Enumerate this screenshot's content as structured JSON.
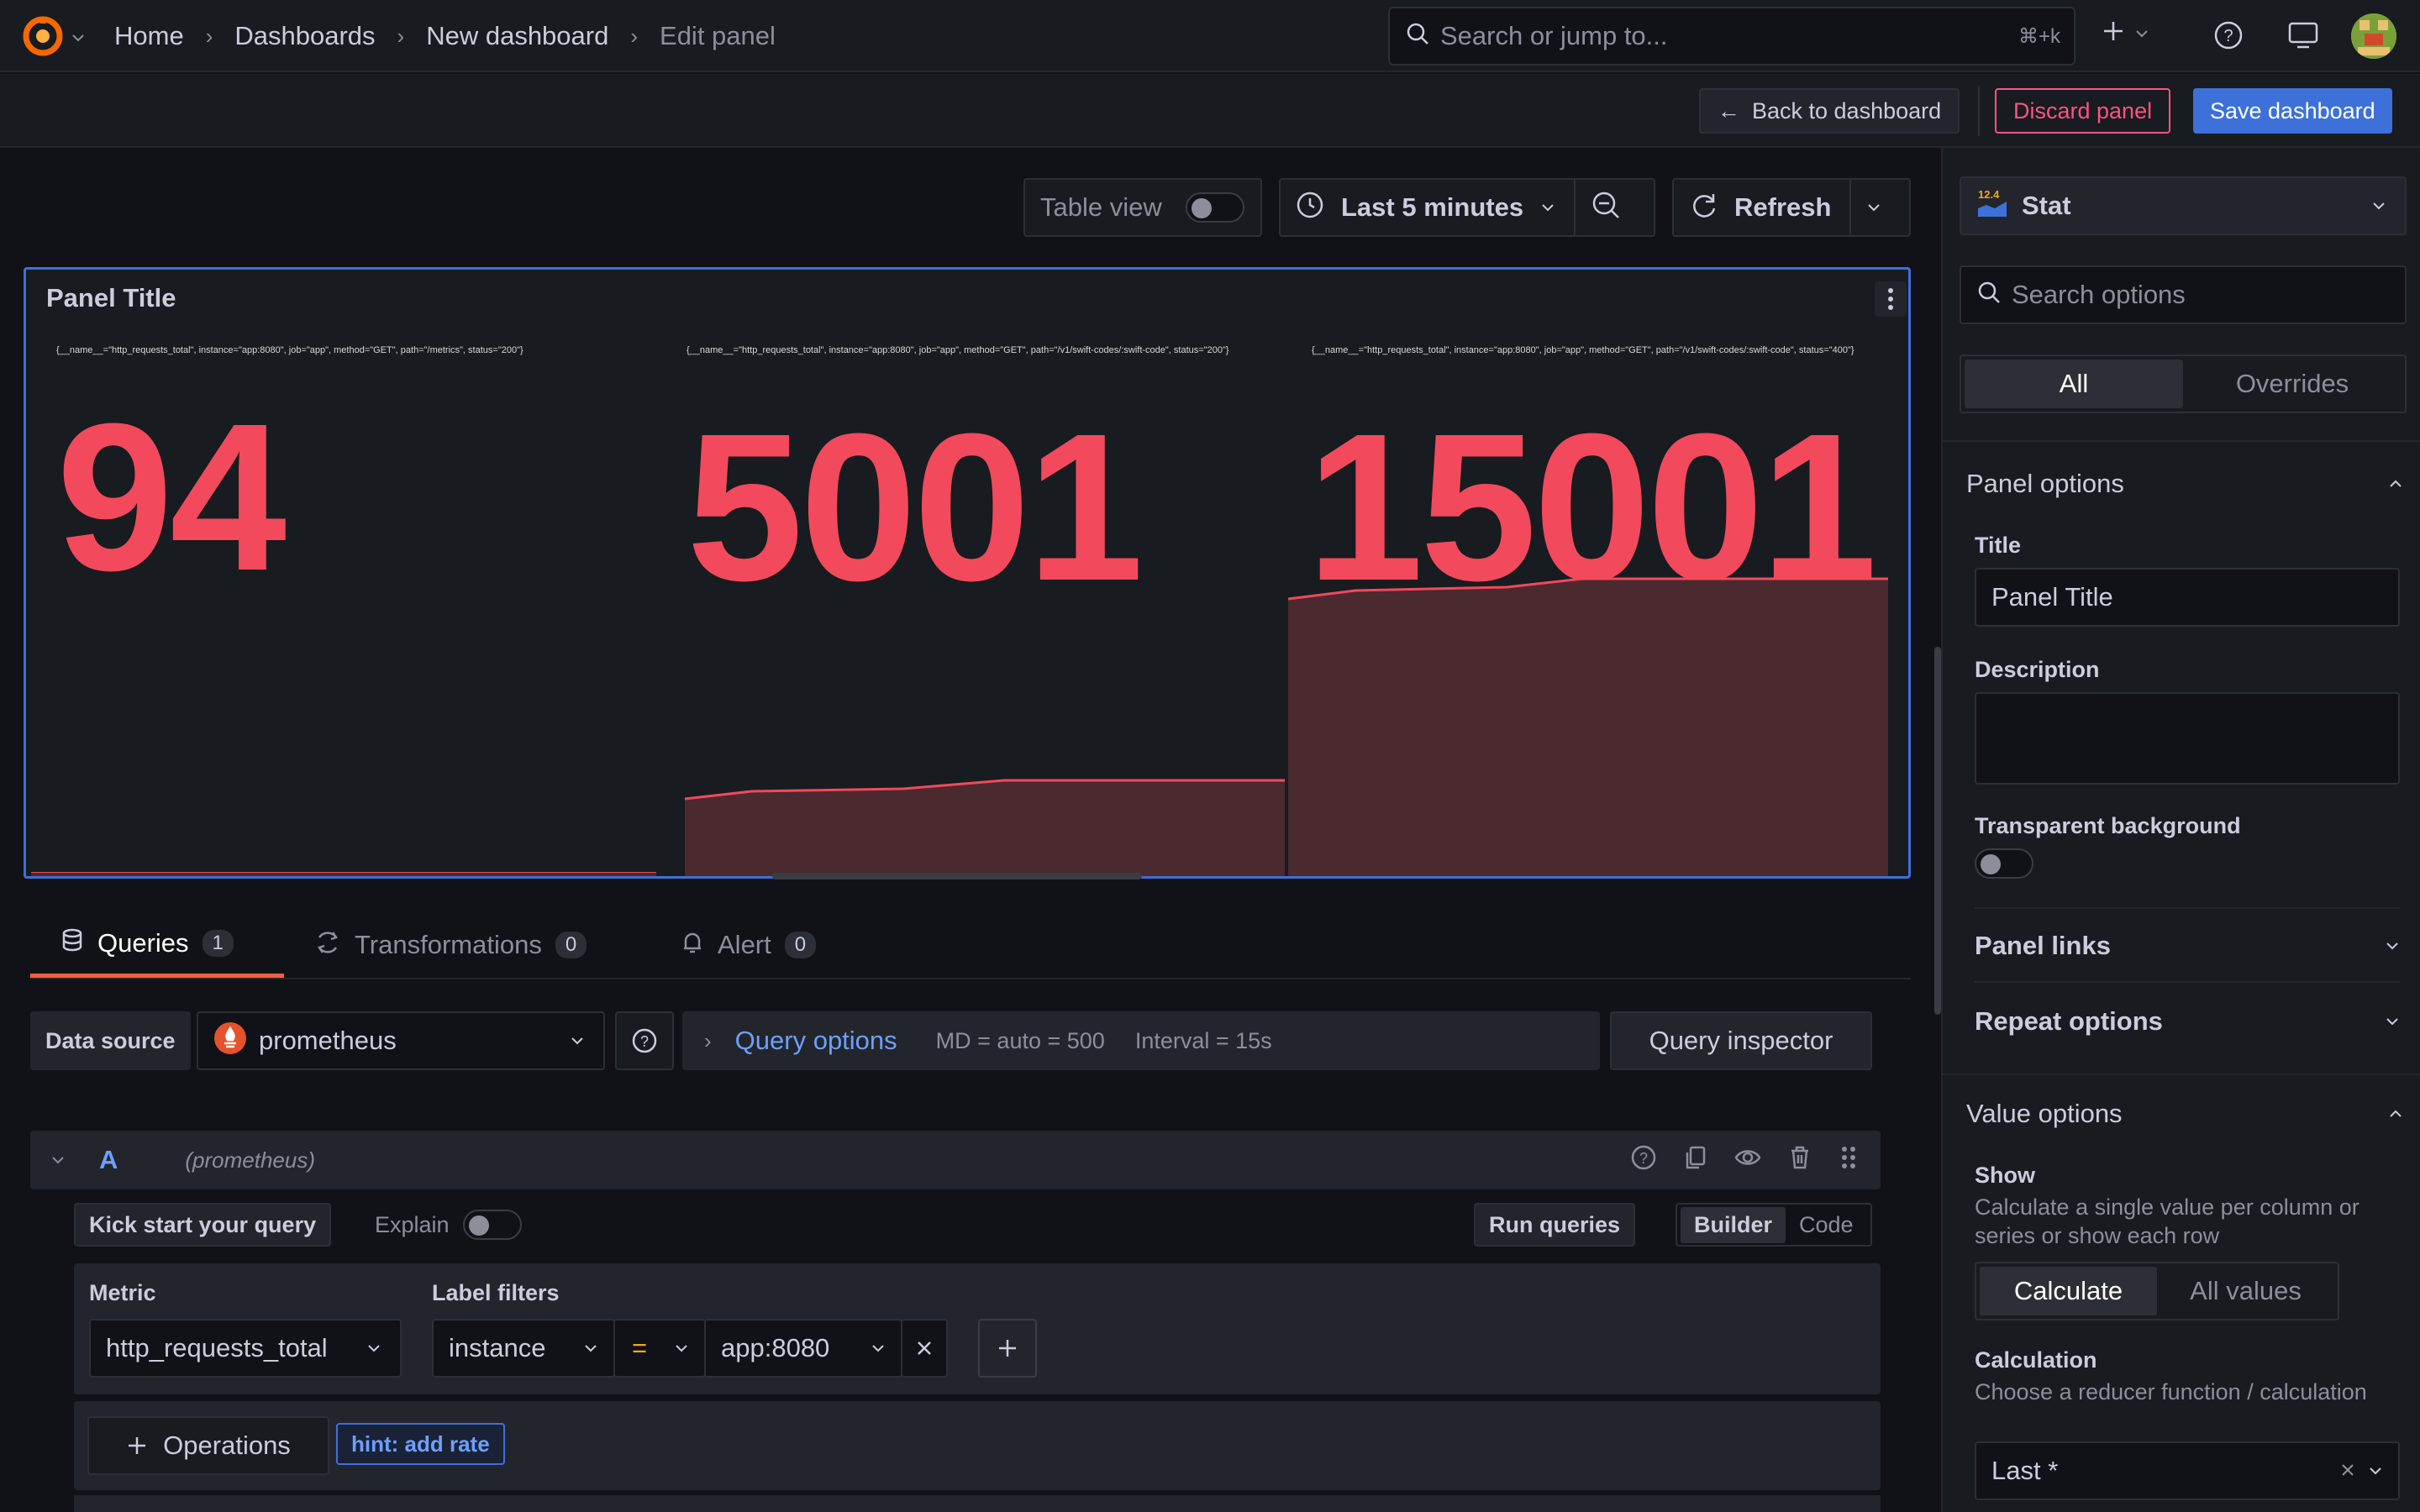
{
  "nav": {
    "breadcrumbs": [
      "Home",
      "Dashboards",
      "New dashboard",
      "Edit panel"
    ],
    "search_placeholder": "Search or jump to...",
    "search_shortcut": "⌘+k"
  },
  "toolbar": {
    "back_label": "Back to dashboard",
    "discard_label": "Discard panel",
    "save_label": "Save dashboard"
  },
  "panel_controls": {
    "table_view_label": "Table view",
    "time_range": "Last 5 minutes",
    "refresh_label": "Refresh"
  },
  "panel": {
    "title": "Panel Title",
    "stats": [
      {
        "label": "{__name__=\"http_requests_total\", instance=\"app:8080\", job=\"app\", method=\"GET\", path=\"/metrics\", status=\"200\"}",
        "value": "94"
      },
      {
        "label": "{__name__=\"http_requests_total\", instance=\"app:8080\", job=\"app\", method=\"GET\", path=\"/v1/swift-codes/:swift-code\", status=\"200\"}",
        "value": "5001"
      },
      {
        "label": "{__name__=\"http_requests_total\", instance=\"app:8080\", job=\"app\", method=\"GET\", path=\"/v1/swift-codes/:swift-code\", status=\"400\"}",
        "value": "15001"
      }
    ]
  },
  "tabs": [
    {
      "label": "Queries",
      "count": "1"
    },
    {
      "label": "Transformations",
      "count": "0"
    },
    {
      "label": "Alert",
      "count": "0"
    }
  ],
  "query": {
    "datasource_label": "Data source",
    "datasource": "prometheus",
    "query_options_label": "Query options",
    "md": "MD = auto = 500",
    "interval": "Interval = 15s",
    "inspector_label": "Query inspector",
    "ref_id": "A",
    "ref_ds": "(prometheus)",
    "kickstart_label": "Kick start your query",
    "explain_label": "Explain",
    "run_label": "Run queries",
    "builder_label": "Builder",
    "code_label": "Code",
    "metric_label": "Metric",
    "metric_value": "http_requests_total",
    "label_filters_label": "Label filters",
    "filter_key": "instance",
    "filter_op": "=",
    "filter_value": "app:8080",
    "operations_label": "Operations",
    "hint_label": "hint: add rate"
  },
  "options": {
    "viz_name": "Stat",
    "search_placeholder": "Search options",
    "all_label": "All",
    "overrides_label": "Overrides",
    "panel_options_title": "Panel options",
    "title_label": "Title",
    "title_value": "Panel Title",
    "description_label": "Description",
    "transparent_label": "Transparent background",
    "panel_links_label": "Panel links",
    "repeat_options_label": "Repeat options",
    "value_options_title": "Value options",
    "show_label": "Show",
    "show_desc": "Calculate a single value per column or series or show each row",
    "calculate_label": "Calculate",
    "all_values_label": "All values",
    "calculation_label": "Calculation",
    "calculation_desc": "Choose a reducer function / calculation",
    "calculation_value": "Last *"
  },
  "colors": {
    "accent": "#3d71d9",
    "stat_value": "#f2495c",
    "danger": "#ff5286",
    "primary": "#3d71d9"
  }
}
